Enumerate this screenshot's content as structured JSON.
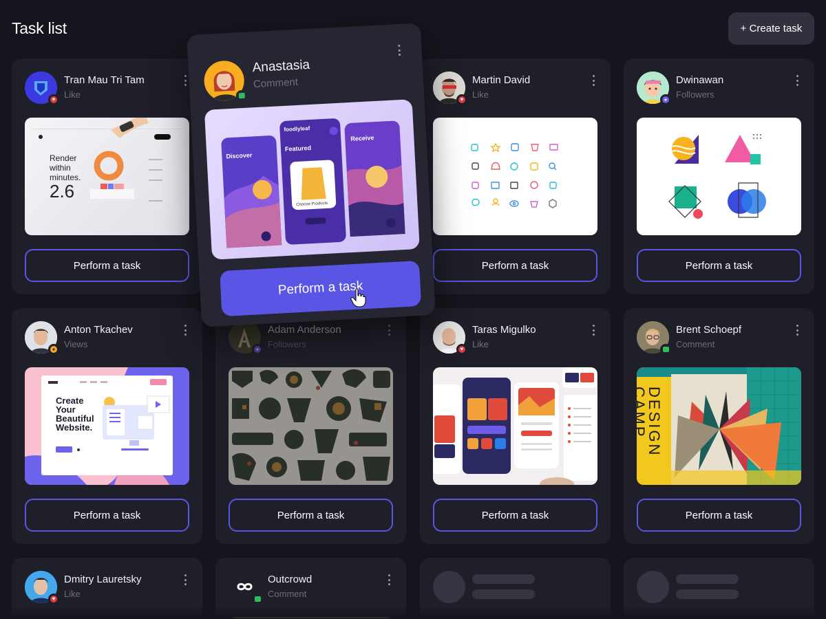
{
  "header": {
    "title": "Task list",
    "create_label": "+ Create task"
  },
  "task_button_label": "Perform a task",
  "cards": [
    {
      "name": "Tran Mau Tri Tam",
      "action": "Like",
      "badge": "heart"
    },
    {
      "name": "Anastasia",
      "action": "Comment",
      "badge": "comment"
    },
    {
      "name": "Martin David",
      "action": "Like",
      "badge": "heart"
    },
    {
      "name": "Dwinawan",
      "action": "Followers",
      "badge": "followers"
    },
    {
      "name": "Anton Tkachev",
      "action": "Views",
      "badge": "eye"
    },
    {
      "name": "Adam Anderson",
      "action": "Followers",
      "badge": "followers"
    },
    {
      "name": "Taras Migulko",
      "action": "Like",
      "badge": "heart"
    },
    {
      "name": "Brent Schoepf",
      "action": "Comment",
      "badge": "comment"
    },
    {
      "name": "Dmitry Lauretsky",
      "action": "Like",
      "badge": "heart"
    },
    {
      "name": "Outcrowd",
      "action": "Comment",
      "badge": "comment"
    }
  ],
  "previews": {
    "render": {
      "line1": "Render",
      "line2": "within",
      "line3": "minutes.",
      "big": "2.6"
    },
    "website": {
      "line1": "Create",
      "line2": "Your",
      "line3": "Beautiful",
      "line4": "Website."
    },
    "foodly": {
      "discover": "Discover",
      "featured": "Featured",
      "receive": "Receive",
      "brand": "foodlyleaf",
      "choose": "Choose Products"
    },
    "camp": {
      "line1": "DESIGN",
      "line2": "CAMP"
    }
  },
  "colors": {
    "background": "#15151d",
    "card": "#1f1f29",
    "accent": "#5b55e6",
    "heart": "#e5393d",
    "comment": "#2ebd59",
    "followers": "#6c5ce7"
  }
}
